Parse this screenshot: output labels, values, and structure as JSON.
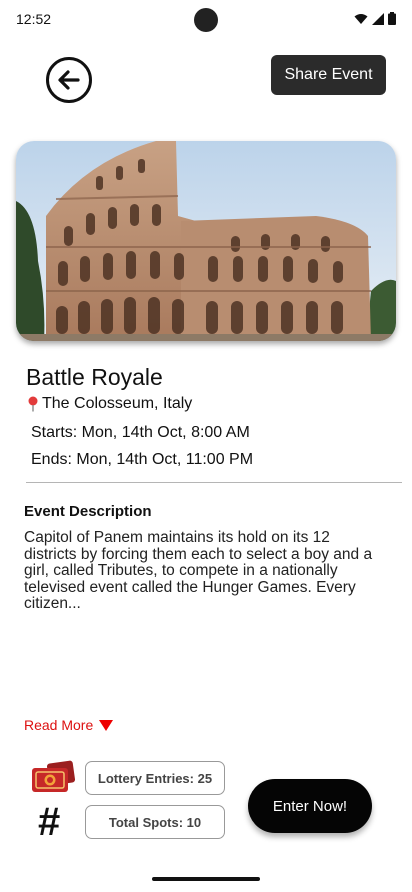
{
  "status_bar": {
    "time": "12:52",
    "icons": [
      "wifi-icon",
      "signal-icon",
      "battery-icon"
    ]
  },
  "header": {
    "back_icon": "arrow-left-circle-icon",
    "share_label": "Share Event"
  },
  "event": {
    "title": "Battle Royale",
    "location_icon": "pin-icon",
    "location": "The Colosseum, Italy",
    "starts": "Starts: Mon, 14th Oct, 8:00 AM",
    "ends": "Ends: Mon, 14th Oct, 11:00 PM",
    "image_subject": "colosseum-photo"
  },
  "description": {
    "heading": "Event Description",
    "text": "Capitol of Panem maintains its hold on its 12 districts by forcing them each to select a boy and a girl, called Tributes, to compete in a nationally televised event called the Hunger Games. Every citizen...",
    "read_more": "Read More"
  },
  "stats": {
    "lottery_label": "Lottery Entries: 25",
    "spots_label": "Total Spots: 10",
    "ticket_icon": "ticket-icon",
    "hash_icon": "hash-icon",
    "hash_glyph": "#"
  },
  "actions": {
    "enter_label": "Enter  Now!"
  },
  "colors": {
    "accent_red": "#dd1111",
    "dark_button": "#2b2b2b",
    "enter_button": "#050505"
  }
}
